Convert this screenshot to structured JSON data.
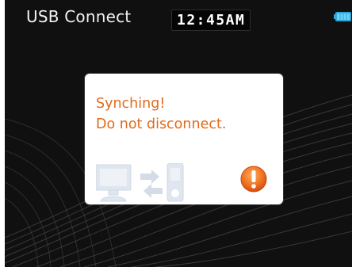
{
  "status_bar": {
    "title": "USB Connect",
    "clock": "12:45AM"
  },
  "icons": {
    "battery": "battery-icon",
    "sync": "computer-to-device-sync-icon",
    "alert": "exclamation-alert-icon"
  },
  "dialog": {
    "line1": "Synching!",
    "line2": "Do not disconnect."
  },
  "colors": {
    "background": "#101010",
    "message_text": "#e06a1c",
    "alert_fill": "#e8621a",
    "battery": "#2fa6d8"
  }
}
